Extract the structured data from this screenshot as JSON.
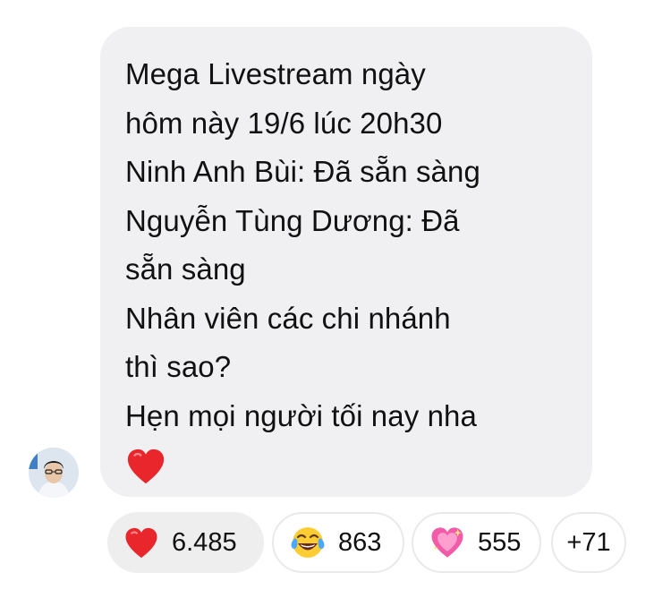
{
  "message": {
    "lines": [
      "Mega Livestream ngày",
      "hôm này 19/6 lúc 20h30",
      "Ninh Anh Bùi: Đã sẵn sàng",
      "Nguyễn Tùng Dương: Đã",
      "sẵn sàng",
      "Nhân viên các chi nhánh",
      "thì sao?",
      "Hẹn mọi người tối nay nha"
    ],
    "trailing_emoji": "red-heart",
    "bubble_color": "#f0f0f2"
  },
  "sender": {
    "avatar": "user-avatar"
  },
  "reactions": [
    {
      "emoji": "red-heart",
      "count": "6.485",
      "selected": true
    },
    {
      "emoji": "face-with-tears-of-joy",
      "count": "863",
      "selected": false
    },
    {
      "emoji": "sparkling-heart",
      "count": "555",
      "selected": false
    },
    {
      "more": "+71"
    }
  ]
}
